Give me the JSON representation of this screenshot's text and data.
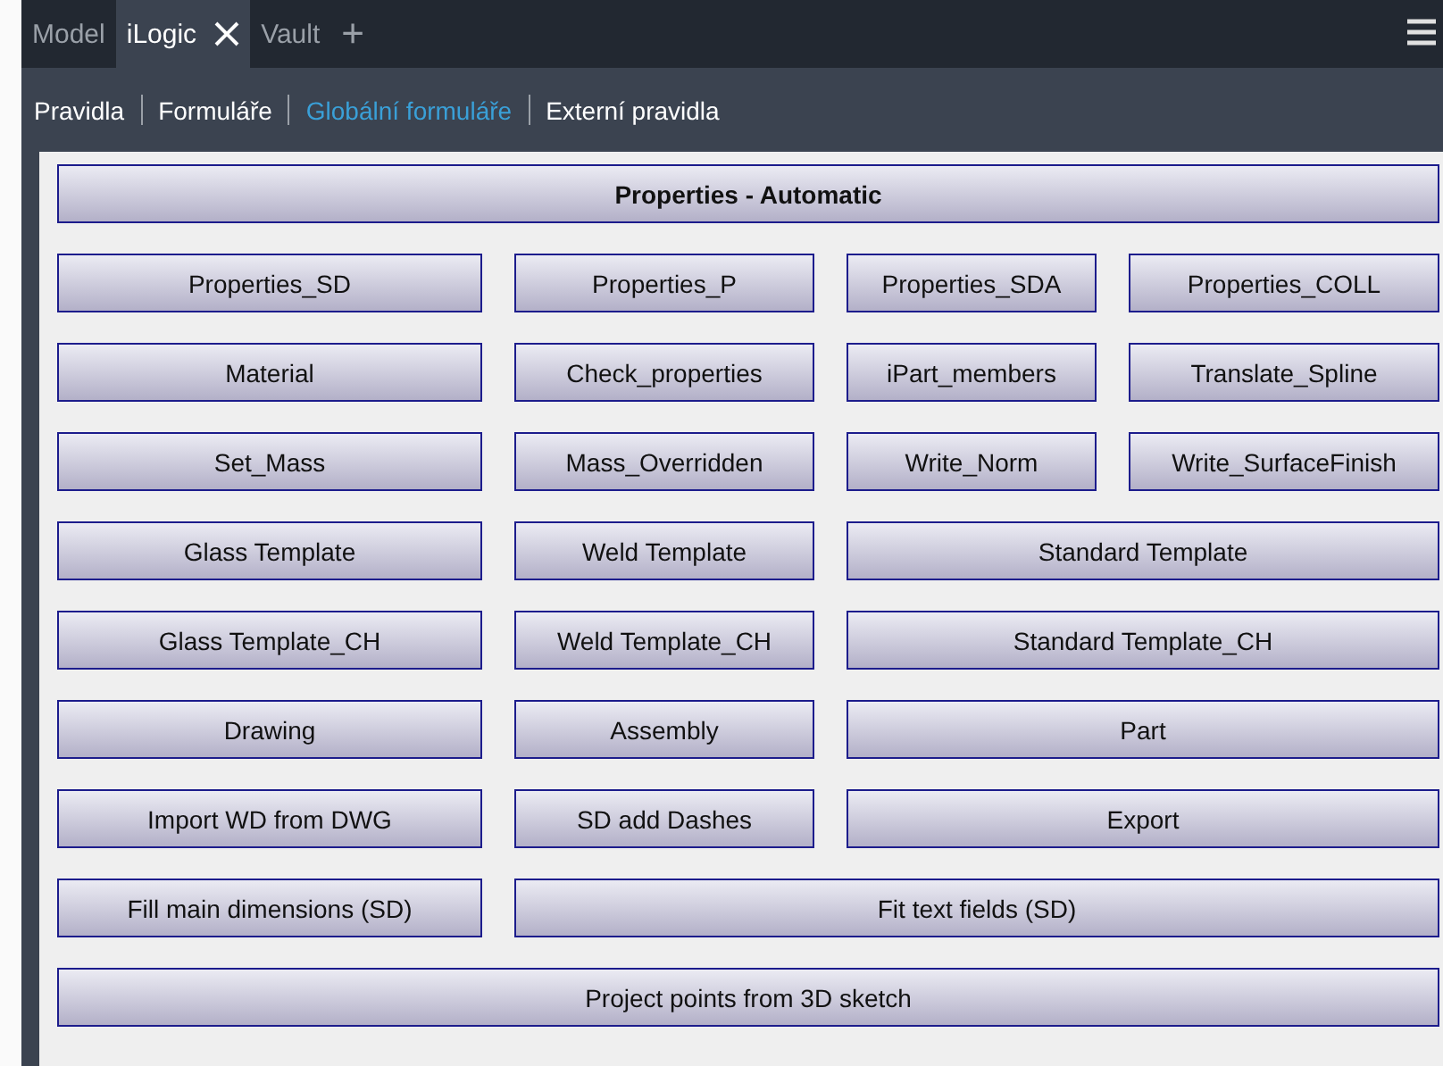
{
  "tabs": [
    {
      "label": "Model",
      "selected": false,
      "closable": false
    },
    {
      "label": "iLogic",
      "selected": true,
      "closable": true
    },
    {
      "label": "Vault",
      "selected": false,
      "closable": false
    }
  ],
  "add_tab": "+",
  "subnav": [
    {
      "label": "Pravidla",
      "selected": false
    },
    {
      "label": "Formuláře",
      "selected": false
    },
    {
      "label": "Globální formuláře",
      "selected": true
    },
    {
      "label": "Externí pravidla",
      "selected": false
    }
  ],
  "form": {
    "title": "Properties - Automatic",
    "rows": [
      [
        "Properties_SD",
        "Properties_P",
        "Properties_SDA",
        "Properties_COLL"
      ],
      [
        "Material",
        "Check_properties",
        "iPart_members",
        "Translate_Spline"
      ],
      [
        "Set_Mass",
        "Mass_Overridden",
        "Write_Norm",
        "Write_SurfaceFinish"
      ],
      [
        "Glass Template",
        "Weld Template",
        "Standard Template"
      ],
      [
        "Glass Template_CH",
        "Weld Template_CH",
        "Standard Template_CH"
      ],
      [
        "Drawing",
        "Assembly",
        "Part"
      ],
      [
        "Import WD from DWG",
        "SD add Dashes",
        "Export"
      ],
      [
        "Fill main dimensions (SD)",
        "Fit text fields (SD)"
      ]
    ],
    "footer_button": "Project points from 3D sketch"
  }
}
